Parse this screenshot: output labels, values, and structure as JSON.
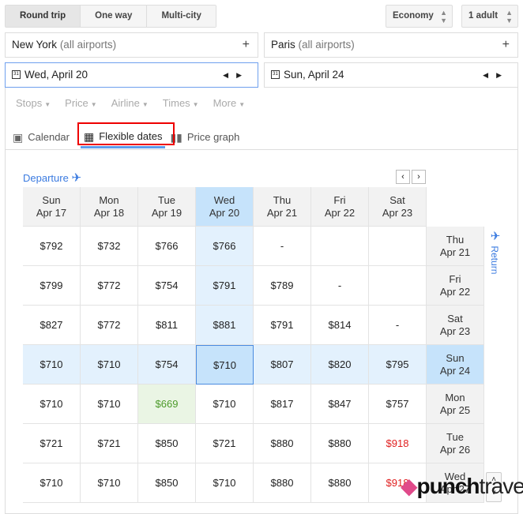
{
  "trip_types": [
    {
      "label": "Round trip",
      "selected": true
    },
    {
      "label": "One way",
      "selected": false
    },
    {
      "label": "Multi-city",
      "selected": false
    }
  ],
  "cabin": "Economy",
  "passengers": "1 adult",
  "origin": {
    "city": "New York",
    "note": "(all airports)"
  },
  "destination": {
    "city": "Paris",
    "note": "(all airports)"
  },
  "depart_date": "Wed, April 20",
  "return_date": "Sun, April 24",
  "filters": [
    "Stops",
    "Price",
    "Airline",
    "Times",
    "More"
  ],
  "views": [
    {
      "label": "Calendar",
      "icon": "calendar-icon"
    },
    {
      "label": "Flexible dates",
      "icon": "grid-icon",
      "selected": true
    },
    {
      "label": "Price graph",
      "icon": "bar-chart-icon"
    }
  ],
  "grid": {
    "departure_label": "Departure",
    "return_label": "Return",
    "departures": [
      [
        "Sun",
        "Apr 17"
      ],
      [
        "Mon",
        "Apr 18"
      ],
      [
        "Tue",
        "Apr 19"
      ],
      [
        "Wed",
        "Apr 20"
      ],
      [
        "Thu",
        "Apr 21"
      ],
      [
        "Fri",
        "Apr 22"
      ],
      [
        "Sat",
        "Apr 23"
      ]
    ],
    "returns": [
      [
        "Thu",
        "Apr 21"
      ],
      [
        "Fri",
        "Apr 22"
      ],
      [
        "Sat",
        "Apr 23"
      ],
      [
        "Sun",
        "Apr 24"
      ],
      [
        "Mon",
        "Apr 25"
      ],
      [
        "Tue",
        "Apr 26"
      ],
      [
        "Wed",
        "Apr 27"
      ]
    ],
    "selected_departure": 3,
    "selected_return": 3,
    "prices": [
      [
        "$792",
        "$732",
        "$766",
        "$766",
        "-",
        "",
        ""
      ],
      [
        "$799",
        "$772",
        "$754",
        "$791",
        "$789",
        "-",
        ""
      ],
      [
        "$827",
        "$772",
        "$811",
        "$881",
        "$791",
        "$814",
        "-"
      ],
      [
        "$710",
        "$710",
        "$754",
        "$710",
        "$807",
        "$820",
        "$795"
      ],
      [
        "$710",
        "$710",
        "$669",
        "$710",
        "$817",
        "$847",
        "$757"
      ],
      [
        "$721",
        "$721",
        "$850",
        "$721",
        "$880",
        "$880",
        "$918"
      ],
      [
        "$710",
        "$710",
        "$850",
        "$710",
        "$880",
        "$880",
        "$918"
      ]
    ],
    "lowest": [
      4,
      2
    ],
    "highest": [
      [
        5,
        6
      ],
      [
        6,
        6
      ]
    ],
    "colors": {
      "selected": "#c6e3fb",
      "lowest": "#4c9a2a",
      "highest": "#e02020"
    }
  },
  "watermark": "punchtravel"
}
